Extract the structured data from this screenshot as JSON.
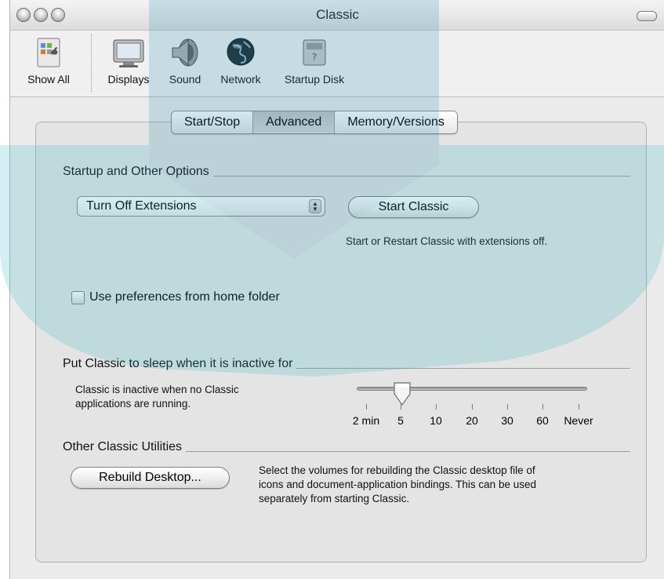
{
  "window": {
    "title": "Classic"
  },
  "toolbar": {
    "items": [
      {
        "label": "Show All",
        "icon": "show-all-icon"
      },
      {
        "label": "Displays",
        "icon": "displays-icon"
      },
      {
        "label": "Sound",
        "icon": "sound-icon"
      },
      {
        "label": "Network",
        "icon": "network-globe-icon"
      },
      {
        "label": "Startup Disk",
        "icon": "startup-disk-icon"
      }
    ]
  },
  "tabs": [
    {
      "label": "Start/Stop",
      "selected": false
    },
    {
      "label": "Advanced",
      "selected": true
    },
    {
      "label": "Memory/Versions",
      "selected": false
    }
  ],
  "startup_section": {
    "heading": "Startup and Other Options",
    "popup_value": "Turn Off Extensions",
    "start_button": "Start Classic",
    "start_description": "Start or Restart Classic with extensions off."
  },
  "preferences_checkbox": {
    "label": "Use preferences from home folder",
    "checked": false
  },
  "sleep_section": {
    "heading": "Put Classic to sleep when it is inactive for",
    "description_line1": "Classic is inactive when no Classic",
    "description_line2": "applications are running.",
    "slider_labels": [
      "2 min",
      "5",
      "10",
      "20",
      "30",
      "60",
      "Never"
    ],
    "slider_value": "5"
  },
  "utilities_section": {
    "heading": "Other Classic Utilities",
    "rebuild_button": "Rebuild Desktop...",
    "rebuild_description_line1": "Select the volumes for rebuilding the Classic desktop file of",
    "rebuild_description_line2": "icons and document-application bindings. This can be used",
    "rebuild_description_line3": "separately from starting Classic."
  },
  "colors": {
    "window_bg": "#ebebeb",
    "panel_bg": "#e4e4e4",
    "watermark": "#2fb5c4"
  }
}
